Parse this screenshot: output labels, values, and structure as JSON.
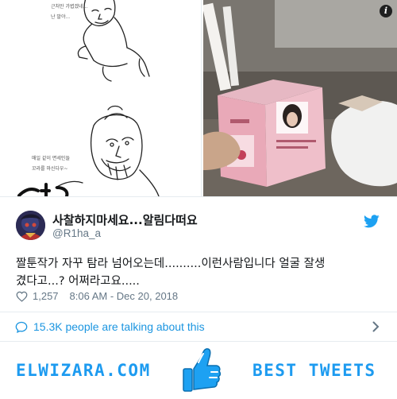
{
  "comic": {
    "caption_top_1": "근처만 가볍겠네...",
    "caption_top_2": "난 말야...",
    "caption_mid_1": "매일 같이 면세인들",
    "caption_mid_2": "꼬라를 마신다우~"
  },
  "tweet": {
    "display_name": "사찰하지마세요...알림다떠요",
    "handle": "@R1ha_a",
    "text_line1": "짤툰작가 자꾸 탐라 넘어오는데..........이런사람입니다 얼굴 잘생",
    "text_line2": "겼다고...? 어쩌라고요.....",
    "like_count": "1,257",
    "timestamp": "8:06 AM - Dec 20, 2018"
  },
  "conversation": {
    "label": "15.3K people are talking about this"
  },
  "footer": {
    "brand": "ELWIZARA.COM",
    "tagline": "BEST TWEETS"
  },
  "colors": {
    "twitter_blue": "#1da1f2",
    "link_blue": "#1b95e0",
    "footer_blue": "#1d9bf0",
    "text_dark": "#14171a",
    "text_gray": "#657786"
  },
  "icons": [
    "info-icon",
    "twitter-bird-icon",
    "heart-icon",
    "speech-bubble-icon",
    "chevron-right-icon",
    "thumbs-up-icon"
  ]
}
